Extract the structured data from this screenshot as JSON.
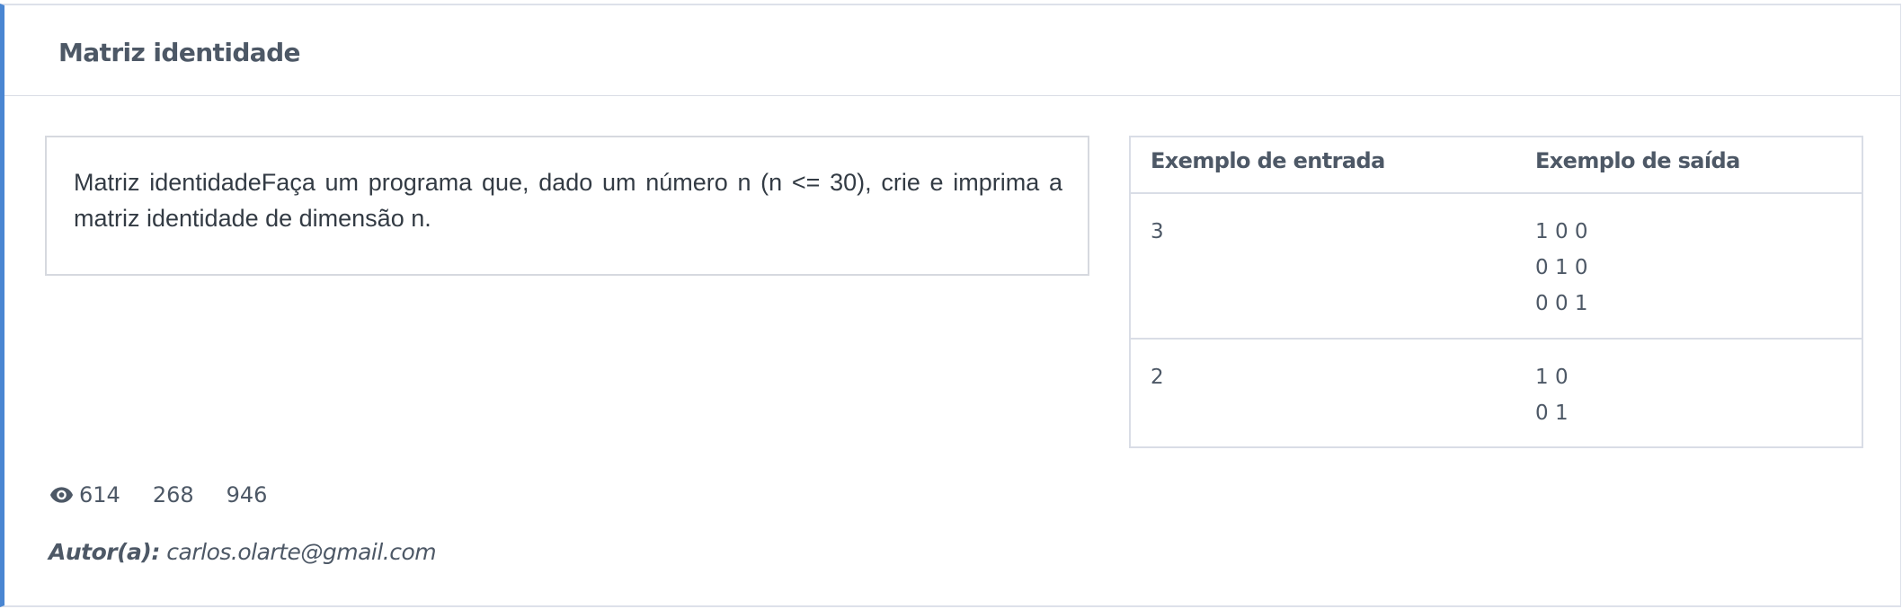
{
  "problem": {
    "title": "Matriz identidade",
    "statement": "Matriz identidadeFaça um programa que, dado um número n (n <= 30), crie e imprima a matriz identidade de dimensão n."
  },
  "examples": {
    "headers": {
      "input": "Exemplo de entrada",
      "output": "Exemplo de saída"
    },
    "rows": [
      {
        "input": "3",
        "output": "1 0 0\n0 1 0\n0 0 1"
      },
      {
        "input": "2",
        "output": "1 0\n0 1"
      }
    ]
  },
  "stats": {
    "views_icon": "eye-icon",
    "views": "614",
    "value_2": "268",
    "value_3": "946"
  },
  "author": {
    "label": "Autor(a):",
    "email": "carlos.olarte@gmail.com"
  },
  "colors": {
    "accent_border": "#4a86d2",
    "text": "#4d5866"
  }
}
